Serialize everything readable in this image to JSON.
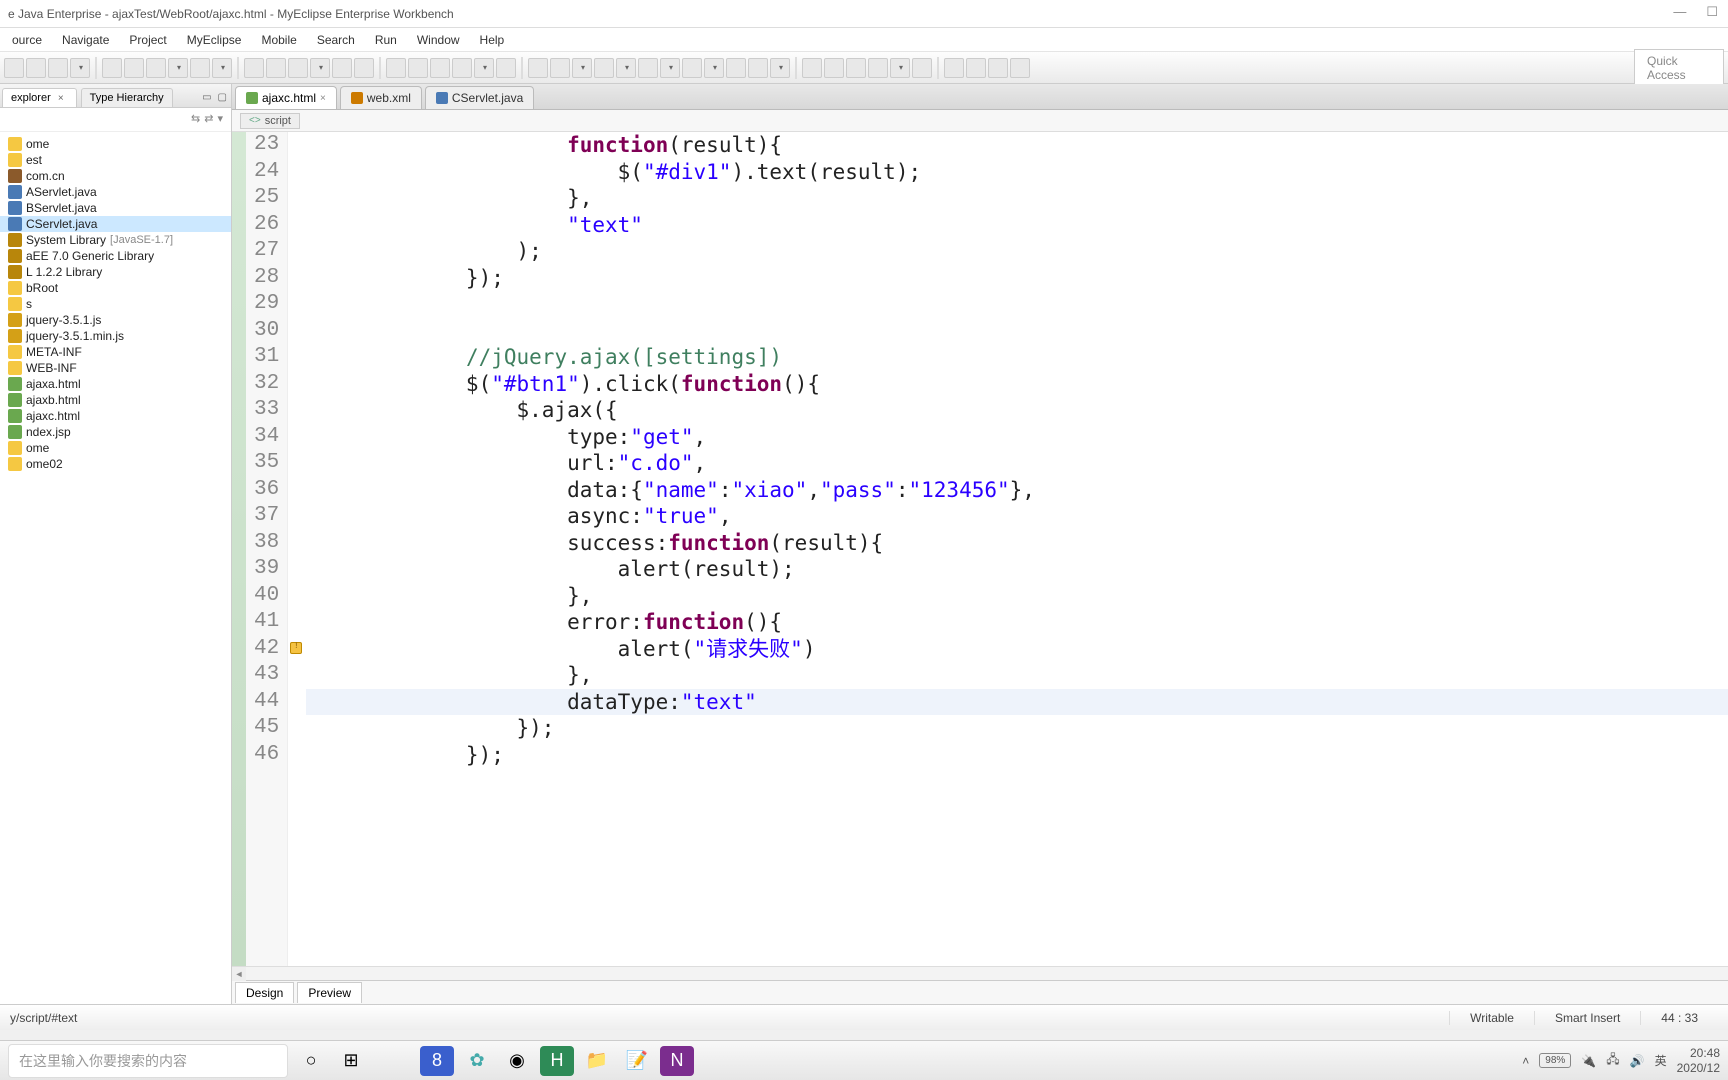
{
  "window": {
    "title": "e Java Enterprise - ajaxTest/WebRoot/ajaxc.html - MyEclipse Enterprise Workbench"
  },
  "win_controls": {
    "min": "—",
    "max": "☐"
  },
  "menu": [
    "ource",
    "Navigate",
    "Project",
    "MyEclipse",
    "Mobile",
    "Search",
    "Run",
    "Window",
    "Help"
  ],
  "quick_access_placeholder": "Quick Access",
  "side": {
    "tabs": {
      "explorer": "explorer",
      "hierarchy": "Type Hierarchy"
    },
    "tree": [
      {
        "label": "ome",
        "cls": "folder"
      },
      {
        "label": "est",
        "cls": "folder"
      },
      {
        "label": "com.cn",
        "cls": "pkg"
      },
      {
        "label": "AServlet.java",
        "cls": "java"
      },
      {
        "label": "BServlet.java",
        "cls": "java"
      },
      {
        "label": "CServlet.java",
        "cls": "java",
        "selected": true
      },
      {
        "label": "System Library",
        "cls": "lib",
        "badge": "[JavaSE-1.7]"
      },
      {
        "label": "aEE 7.0 Generic Library",
        "cls": "lib"
      },
      {
        "label": "L 1.2.2 Library",
        "cls": "lib"
      },
      {
        "label": "bRoot",
        "cls": "folder"
      },
      {
        "label": "s",
        "cls": "folder"
      },
      {
        "label": "jquery-3.5.1.js",
        "cls": "js"
      },
      {
        "label": "jquery-3.5.1.min.js",
        "cls": "js"
      },
      {
        "label": "META-INF",
        "cls": "folder"
      },
      {
        "label": "WEB-INF",
        "cls": "folder"
      },
      {
        "label": "ajaxa.html",
        "cls": "html"
      },
      {
        "label": "ajaxb.html",
        "cls": "html"
      },
      {
        "label": "ajaxc.html",
        "cls": "html"
      },
      {
        "label": "ndex.jsp",
        "cls": "html"
      },
      {
        "label": "ome",
        "cls": "folder"
      },
      {
        "label": "ome02",
        "cls": "folder"
      }
    ]
  },
  "editor_tabs": [
    {
      "label": "ajaxc.html",
      "icon": "",
      "active": true,
      "closeable": true
    },
    {
      "label": "web.xml",
      "icon": "xml",
      "active": false,
      "closeable": false
    },
    {
      "label": "CServlet.java",
      "icon": "java",
      "active": false,
      "closeable": false
    }
  ],
  "breadcrumb": {
    "label": "script"
  },
  "code": {
    "first_line": 23,
    "highlight_line": 44,
    "quickfix_line": 42,
    "lines": [
      [
        [
          "                    "
        ],
        [
          "kw",
          "function"
        ],
        [
          "",
          "(result){"
        ]
      ],
      [
        [
          "                        $("
        ],
        [
          "str",
          "\"#div1\""
        ],
        [
          "",
          ").text(result);"
        ]
      ],
      [
        [
          "",
          "                    },"
        ]
      ],
      [
        [
          "                    "
        ],
        [
          "str",
          "\"text\""
        ]
      ],
      [
        [
          "",
          "                );"
        ]
      ],
      [
        [
          "",
          "            });"
        ]
      ],
      [
        [
          "",
          ""
        ]
      ],
      [
        [
          "",
          ""
        ]
      ],
      [
        [
          "            "
        ],
        [
          "cmt",
          "//jQuery.ajax([settings])"
        ]
      ],
      [
        [
          "            $("
        ],
        [
          "str",
          "\"#btn1\""
        ],
        [
          "",
          ").click("
        ],
        [
          "kw",
          "function"
        ],
        [
          "",
          "(){"
        ]
      ],
      [
        [
          "",
          "                $.ajax({"
        ]
      ],
      [
        [
          "                    type:"
        ],
        [
          "str",
          "\"get\""
        ],
        [
          "",
          ","
        ]
      ],
      [
        [
          "                    url:"
        ],
        [
          "str",
          "\"c.do\""
        ],
        [
          "",
          ","
        ]
      ],
      [
        [
          "                    data:{"
        ],
        [
          "str",
          "\"name\""
        ],
        [
          "",
          ":"
        ],
        [
          "str",
          "\"xiao\""
        ],
        [
          "",
          ","
        ],
        [
          "str",
          "\"pass\""
        ],
        [
          "",
          ":"
        ],
        [
          "str",
          "\"123456\""
        ],
        [
          "",
          "},"
        ]
      ],
      [
        [
          "                    async:"
        ],
        [
          "str",
          "\"true\""
        ],
        [
          "",
          ","
        ]
      ],
      [
        [
          "                    success:"
        ],
        [
          "kw",
          "function"
        ],
        [
          "",
          "(result){"
        ]
      ],
      [
        [
          "",
          "                        alert(result);"
        ]
      ],
      [
        [
          "",
          "                    },"
        ]
      ],
      [
        [
          "                    error:"
        ],
        [
          "kw",
          "function"
        ],
        [
          "",
          "(){"
        ]
      ],
      [
        [
          "                        alert("
        ],
        [
          "str",
          "\"请求失败\""
        ],
        [
          "",
          ")"
        ]
      ],
      [
        [
          "",
          "                    },"
        ]
      ],
      [
        [
          "                    dataType:"
        ],
        [
          "str",
          "\"text\""
        ]
      ],
      [
        [
          "",
          "                });"
        ]
      ],
      [
        [
          "",
          "            });"
        ]
      ]
    ]
  },
  "bottom_tabs": [
    "Design",
    "Preview"
  ],
  "status": {
    "path": "y/script/#text",
    "writable": "Writable",
    "mode": "Smart Insert",
    "pos": "44 : 33"
  },
  "taskbar": {
    "search_placeholder": "在这里输入你要搜索的内容",
    "battery": "98%",
    "ime": "英",
    "time": "20:48",
    "date": "2020/12"
  }
}
